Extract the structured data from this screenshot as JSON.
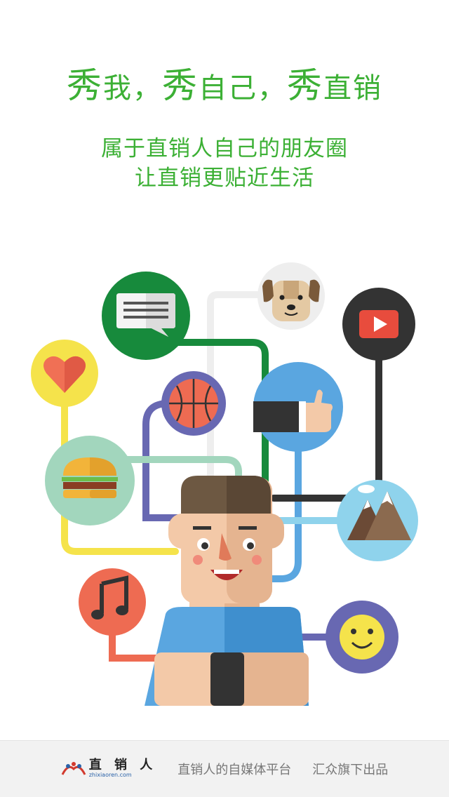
{
  "headline": {
    "part1_big": "秀",
    "part1": "我，",
    "part2_big": "秀",
    "part2": "自己，",
    "part3_big": "秀",
    "part3": "直销"
  },
  "subtitle": {
    "line1": "属于直销人自己的朋友圈",
    "line2": "让直销更贴近生活"
  },
  "illustration": {
    "icons": [
      "chat-bubble-icon",
      "dog-icon",
      "play-video-icon",
      "heart-icon",
      "basketball-icon",
      "thumbs-up-icon",
      "burger-icon",
      "mountain-icon",
      "music-note-icon",
      "smiley-icon"
    ],
    "colors": {
      "green": "#178a3c",
      "yellow": "#f5e34b",
      "dark": "#333333",
      "blue": "#5aa6e0",
      "mint": "#a2d6bd",
      "skyblue": "#8fd3ec",
      "coral": "#ee6b52",
      "purple": "#6868b2"
    }
  },
  "footer": {
    "logo_cn": "直 销 人",
    "logo_en": "zhixiaoren.com",
    "tagline": "直销人的自媒体平台",
    "producer": "汇众旗下出品"
  }
}
